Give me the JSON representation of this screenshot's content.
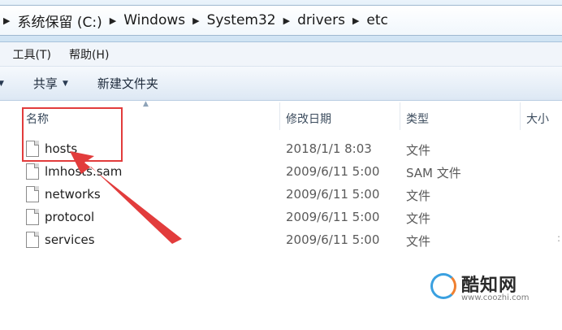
{
  "address_bar": {
    "crumbs": [
      "系统保留 (C:)",
      "Windows",
      "System32",
      "drivers",
      "etc"
    ]
  },
  "menu": {
    "items": [
      "具(T)",
      "工具(T)",
      "帮助(H)"
    ]
  },
  "toolbar": {
    "share_label": "共享",
    "new_folder_label": "新建文件夹"
  },
  "columns": {
    "name": "名称",
    "modified": "修改日期",
    "type": "类型",
    "size": "大小"
  },
  "files": [
    {
      "name": "hosts",
      "modified": "2018/1/1 8:03",
      "type": "文件"
    },
    {
      "name": "lmhosts.sam",
      "modified": "2009/6/11 5:00",
      "type": "SAM 文件"
    },
    {
      "name": "networks",
      "modified": "2009/6/11 5:00",
      "type": "文件"
    },
    {
      "name": "protocol",
      "modified": "2009/6/11 5:00",
      "type": "文件"
    },
    {
      "name": "services",
      "modified": "2009/6/11 5:00",
      "type": "文件"
    }
  ],
  "watermark": {
    "brand": "酷知网",
    "url": "www.coozhi.com"
  },
  "colors": {
    "annotation": "#e23c3c",
    "toolbar_bg": "#dde8f4"
  },
  "icons": [
    "chevron-right-icon",
    "dropdown-arrow-icon",
    "sort-arrow-icon",
    "file-icon"
  ]
}
